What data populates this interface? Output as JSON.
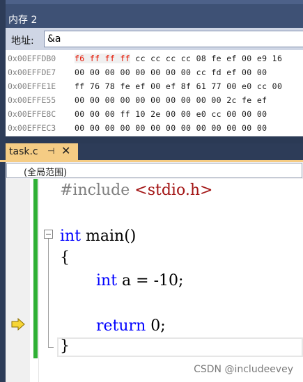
{
  "memory_window": {
    "title": "内存 2",
    "address_label": "地址:",
    "address_value": "&a",
    "highlight_color": "#e51400",
    "rows": [
      {
        "address": "0x00EFFDB0",
        "highlighted": "f6 ff ff ff",
        "bytes": " cc cc cc cc 08 fe ef 00 e9 16"
      },
      {
        "address": "0x00EFFDE7",
        "highlighted": "",
        "bytes": "00 00 00 00 00 00 00 00 cc fd ef 00 00"
      },
      {
        "address": "0x00EFFE1E",
        "highlighted": "",
        "bytes": "ff 76 78 fe ef 00 ef 8f 61 77 00 e0 cc 00"
      },
      {
        "address": "0x00EFFE55",
        "highlighted": "",
        "bytes": "00 00 00 00 00 00 00 00 00 00 2c fe ef"
      },
      {
        "address": "0x00EFFE8C",
        "highlighted": "",
        "bytes": "00 00 00 ff 10 2e 00 00 e0 cc 00 00 00"
      },
      {
        "address": "0x00EFFEC3",
        "highlighted": "",
        "bytes": "00 00 00 00 00 00 00 00 00 00 00 00 00"
      }
    ]
  },
  "editor": {
    "tab_title": "task.c",
    "pin_icon": "pin-icon",
    "close_icon": "close-icon",
    "scope": "(全局范围)",
    "current_line_icon": "current-line-arrow-icon",
    "code": {
      "include_directive": "#include",
      "include_file": "<stdio.h>",
      "type_int": "int",
      "main_signature": " main()",
      "open_brace": "{",
      "decl_type": "int",
      "decl_rest": " a = -10;",
      "return_kw": "return",
      "return_rest": " 0;",
      "close_brace": "}"
    }
  },
  "watermark": "CSDN @includeevey"
}
